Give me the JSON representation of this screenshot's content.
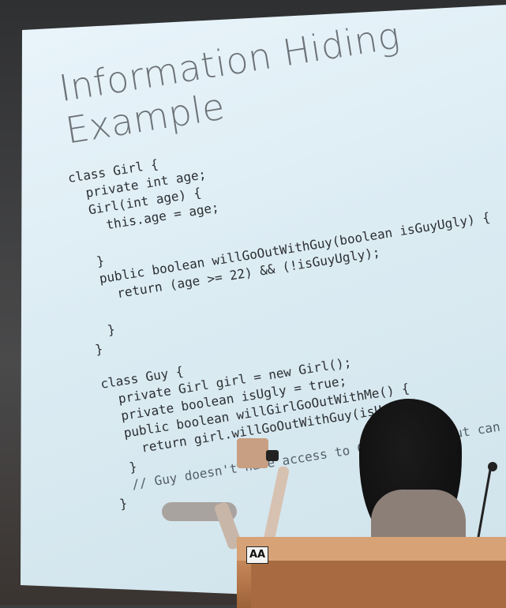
{
  "slide": {
    "title_line1": "Information Hiding",
    "title_line2": "Example",
    "code_lines": [
      "class Girl {",
      "  private int age;",
      "  Girl(int age) {",
      "    this.age = age;",
      "",
      "  }",
      "  public boolean willGoOutWithGuy(boolean isGuyUgly) {",
      "    return (age >= 22) && (!isGuyUgly);",
      "",
      "  }",
      "}",
      "",
      "class Guy {",
      "  private Girl girl = new Girl();",
      "  private boolean isUgly = true;",
      "  public boolean willGirlGoOutWithMe() {",
      "    return girl.willGoOutWithGuy(isUgly);",
      "  }",
      "  // Guy doesn't have access to Girl's age. but can ask her",
      "}"
    ]
  },
  "lectern": {
    "label": "AA"
  },
  "colors": {
    "slide_bg": "#dcecf3",
    "title": "#6d7378",
    "code": "#2b2f33",
    "lectern": "#b8794c"
  }
}
